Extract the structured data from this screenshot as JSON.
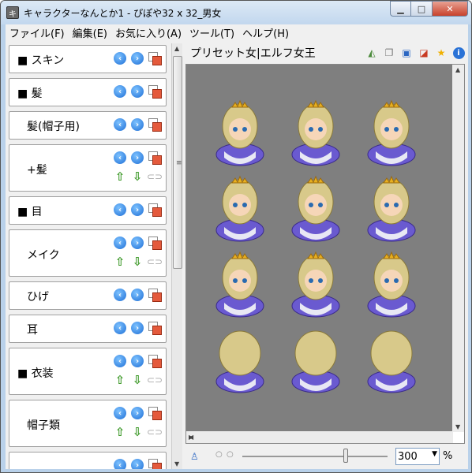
{
  "window": {
    "title": "キャラクターなんとか1 - ぴぽや32 x 32_男女",
    "icon": "app-icon",
    "minimize": "0",
    "maximize": "1",
    "close": "r"
  },
  "menu": [
    "ファイル(F)",
    "編集(E)",
    "お気に入り(A)",
    "ツール(T)",
    "ヘルプ(H)"
  ],
  "parts": [
    {
      "label": "■ スキン",
      "has_arrows": false
    },
    {
      "label": "■ 髪",
      "has_arrows": false
    },
    {
      "label": "髪(帽子用)",
      "has_arrows": false
    },
    {
      "label": "+髪",
      "has_arrows": true
    },
    {
      "label": "■ 目",
      "has_arrows": false
    },
    {
      "label": "メイク",
      "has_arrows": true
    },
    {
      "label": "ひげ",
      "has_arrows": false
    },
    {
      "label": "耳",
      "has_arrows": false
    },
    {
      "label": "■ 衣装",
      "has_arrows": true
    },
    {
      "label": "帽子類",
      "has_arrows": true
    },
    {
      "label": "",
      "has_arrows": false
    }
  ],
  "part_icons": {
    "prev": "previous-icon",
    "next": "next-icon",
    "copy": "copy-layer-icon",
    "up": "up-arrow-icon",
    "down": "down-arrow-icon",
    "link": "link-icon"
  },
  "preview": {
    "preset_label": "プリセット女|エルフ女王",
    "toolbar_icons": [
      "flip-icon",
      "copy-icon",
      "save-icon",
      "layers-icon",
      "favorite-star-icon",
      "info-icon"
    ],
    "sprite_rows": [
      "front",
      "left",
      "right",
      "back"
    ],
    "columns": 3
  },
  "zoom": {
    "value": "300",
    "unit": "%"
  },
  "colors": {
    "accent": "#1f6fd6",
    "canvas": "#7f7f7f",
    "hair": "#d8c98a",
    "dress": "#6a5ad0"
  }
}
